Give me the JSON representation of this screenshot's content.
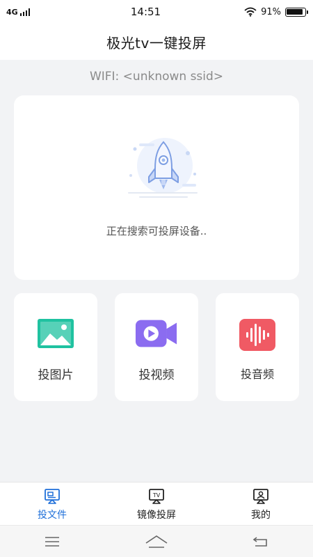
{
  "status_bar": {
    "network": "4G",
    "time": "14:51",
    "battery_text": "91%",
    "battery_level": 0.91
  },
  "header": {
    "title": "极光tv一键投屏"
  },
  "wifi": {
    "label": "WIFI: <unknown ssid>"
  },
  "device_search": {
    "status_text": "正在搜索可投屏设备.."
  },
  "features": [
    {
      "label": "投图片",
      "icon": "image-icon",
      "color": "#1fc2a0"
    },
    {
      "label": "投视频",
      "icon": "video-camera-icon",
      "color": "#8b6cf0"
    },
    {
      "label": "投音频",
      "icon": "audio-wave-icon",
      "color": "#f05a64"
    }
  ],
  "tabs": [
    {
      "label": "投文件",
      "icon": "cast-file-icon",
      "active": true
    },
    {
      "label": "镜像投屏",
      "icon": "tv-icon",
      "active": false
    },
    {
      "label": "我的",
      "icon": "profile-icon",
      "active": false
    }
  ],
  "colors": {
    "accent": "#1e6fd9",
    "background": "#f2f3f5"
  }
}
